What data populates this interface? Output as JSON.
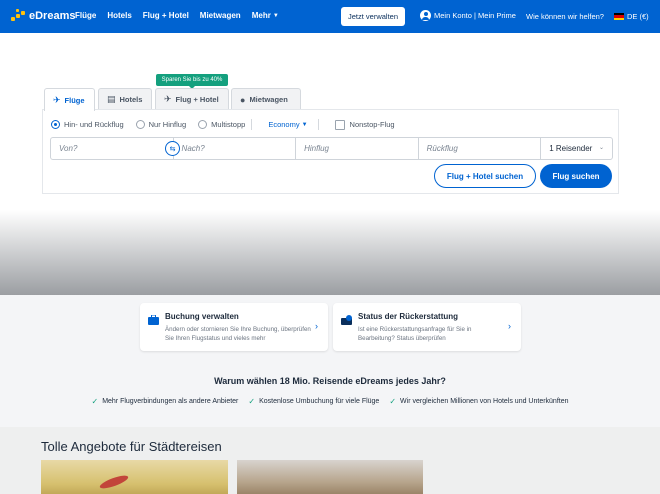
{
  "header": {
    "logo_text": "eDreams",
    "nav": [
      {
        "label": "Flüge"
      },
      {
        "label": "Hotels"
      },
      {
        "label": "Flug + Hotel"
      },
      {
        "label": "Mietwagen"
      },
      {
        "label": "Mehr"
      }
    ],
    "manage_button": "Jetzt verwalten",
    "account": "Mein Konto | Mein Prime",
    "help": "Wie können wir helfen?",
    "language": "DE (€)"
  },
  "promo_badge": "Sparen Sie bis zu 40%",
  "tabs": [
    {
      "label": "Flüge",
      "icon": "plane-icon"
    },
    {
      "label": "Hotels",
      "icon": "bed-icon"
    },
    {
      "label": "Flug + Hotel",
      "icon": "plane-bed-icon"
    },
    {
      "label": "Mietwagen",
      "icon": "car-icon"
    }
  ],
  "search": {
    "trip_types": [
      "Hin- und Rückflug",
      "Nur Hinflug",
      "Multistopp"
    ],
    "selected_trip_type": "Hin- und Rückflug",
    "cabin": "Economy",
    "nonstop_label": "Nonstop-Flug",
    "from_placeholder": "Von?",
    "to_placeholder": "Nach?",
    "departure_placeholder": "Hinflug",
    "return_placeholder": "Rückflug",
    "travellers": "1 Reisender",
    "flight_hotel_button": "Flug + Hotel suchen",
    "search_button": "Flug suchen"
  },
  "cards": [
    {
      "title": "Buchung verwalten",
      "text": "Ändern oder stornieren Sie Ihre Buchung, überprüfen Sie Ihren Flugstatus und vieles mehr"
    },
    {
      "title": "Status der Rückerstattung",
      "text": "Ist eine Rückerstattungsanfrage für Sie in Bearbeitung? Status überprüfen"
    }
  ],
  "why_title": "Warum wählen 18 Mio. Reisende eDreams jedes Jahr?",
  "benefits": [
    "Mehr Flugverbindungen als andere Anbieter",
    "Kostenlose Umbuchung für viele Flüge",
    "Wir vergleichen Millionen von Hotels und Unterkünften"
  ],
  "offers_title": "Tolle Angebote für Städtereisen",
  "colors": {
    "brand": "#0063d1",
    "promo": "#14a07e",
    "logo": "#ffc20e"
  }
}
